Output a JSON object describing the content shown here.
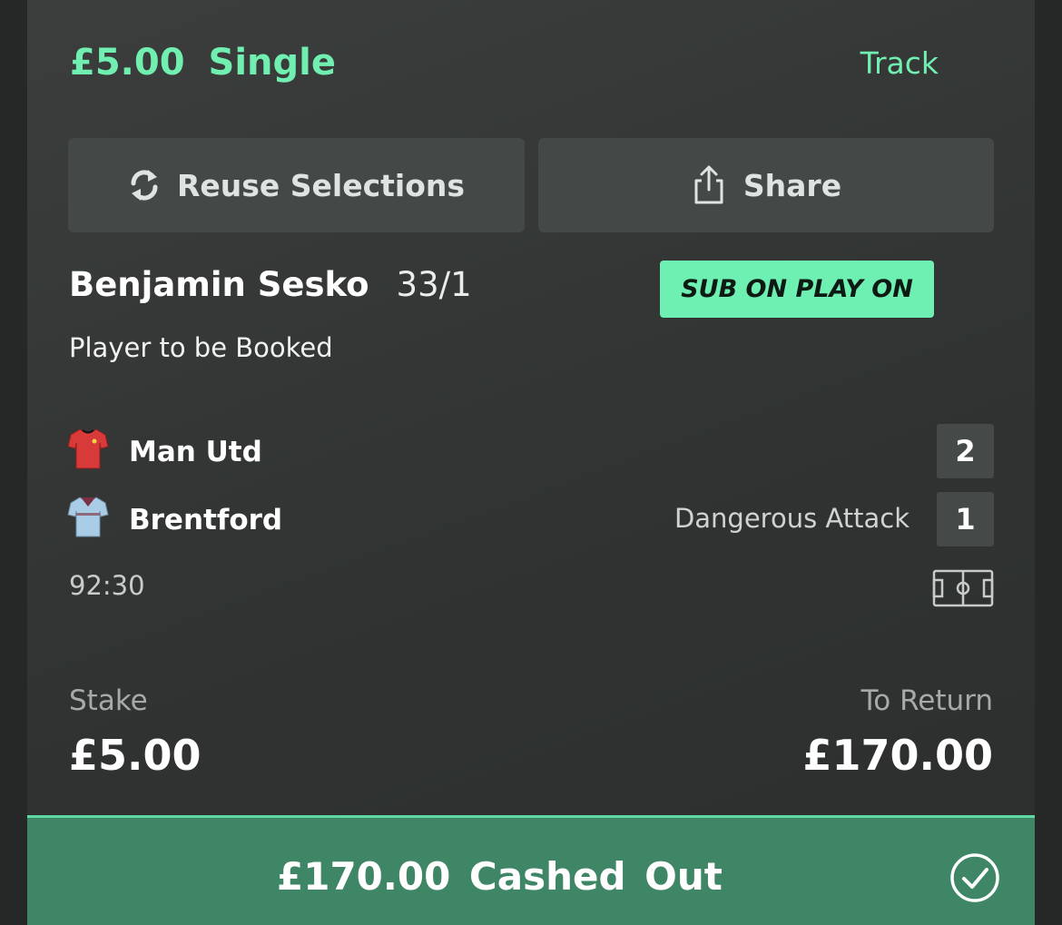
{
  "header": {
    "amount": "£5.00",
    "bet_type": "Single",
    "track_label": "Track"
  },
  "actions": {
    "reuse_label": "Reuse Selections",
    "share_label": "Share"
  },
  "selection": {
    "player": "Benjamin Sesko",
    "odds": "33/1",
    "badge": "SUB ON PLAY ON",
    "market": "Player to be Booked"
  },
  "match": {
    "home_team": "Man Utd",
    "home_score": "2",
    "away_team": "Brentford",
    "away_score": "1",
    "status": "Dangerous Attack",
    "clock": "92:30"
  },
  "summary": {
    "stake_label": "Stake",
    "stake_value": "£5.00",
    "return_label": "To Return",
    "return_value": "£170.00"
  },
  "cashout": {
    "label": "£170.00 Cashed Out"
  },
  "colors": {
    "accent": "#70efb1",
    "background": "#303332",
    "cashout": "#3e8665"
  },
  "icons": [
    "refresh-icon",
    "share-icon",
    "home-shirt-icon",
    "away-shirt-icon",
    "pitch-icon",
    "check-circle-icon"
  ]
}
